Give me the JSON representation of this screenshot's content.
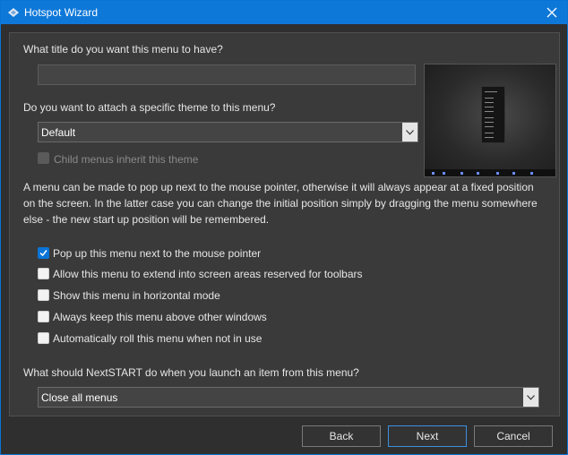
{
  "window": {
    "title": "Hotspot Wizard"
  },
  "form": {
    "title_question": "What title do you want this menu to have?",
    "title_value": "",
    "theme_question": "Do you want to attach a specific theme to this menu?",
    "theme_value": "Default",
    "child_inherit_label": "Child menus inherit this theme",
    "description": "A menu can be made to pop up next to the mouse pointer, otherwise it will always appear at a fixed position on the screen. In the latter case you can change the initial position simply by dragging the menu somewhere else - the new start up position will be remembered.",
    "options": [
      {
        "label": "Pop up this menu next to the mouse pointer",
        "checked": true
      },
      {
        "label": "Allow this menu to extend into screen areas reserved for toolbars",
        "checked": false
      },
      {
        "label": "Show this menu in horizontal mode",
        "checked": false
      },
      {
        "label": "Always keep this menu above other windows",
        "checked": false
      },
      {
        "label": "Automatically roll this menu when not in use",
        "checked": false
      }
    ],
    "launch_question": "What should NextSTART do when you launch an item from this menu?",
    "launch_value": "Close all menus"
  },
  "buttons": {
    "back": "Back",
    "next": "Next",
    "cancel": "Cancel"
  },
  "colors": {
    "titlebar": "#0e78d8",
    "accent": "#0a74d6",
    "panel": "#3a3a3a"
  }
}
